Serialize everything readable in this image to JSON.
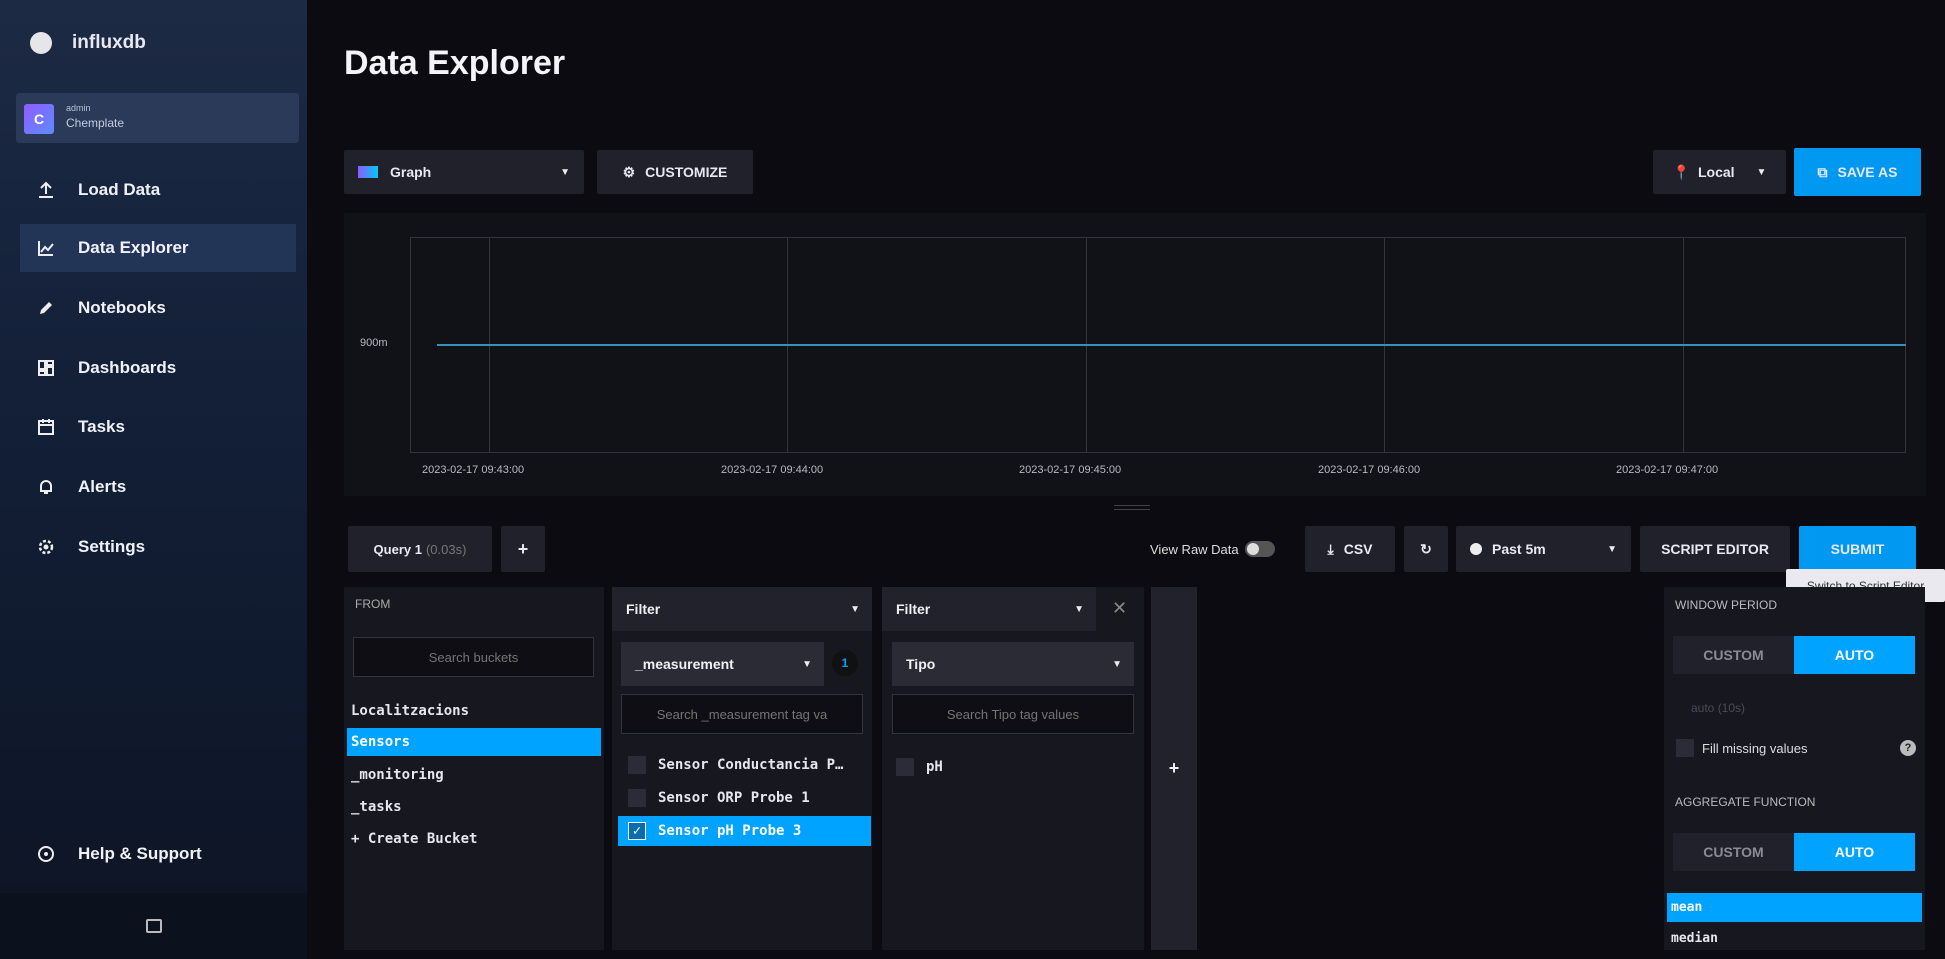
{
  "sidebar": {
    "brand": "influxdb",
    "user": {
      "initial": "C",
      "role": "admin",
      "org": "Chemplate"
    },
    "items": [
      {
        "label": "Load Data",
        "icon": "upload-icon"
      },
      {
        "label": "Data Explorer",
        "icon": "graph-icon"
      },
      {
        "label": "Notebooks",
        "icon": "pencil-icon"
      },
      {
        "label": "Dashboards",
        "icon": "dashboard-grid-icon"
      },
      {
        "label": "Tasks",
        "icon": "calendar-icon"
      },
      {
        "label": "Alerts",
        "icon": "bell-icon"
      },
      {
        "label": "Settings",
        "icon": "gear-icon"
      }
    ],
    "help": "Help & Support"
  },
  "page": {
    "title": "Data Explorer"
  },
  "toolbar": {
    "vis_type": "Graph",
    "customize": "CUSTOMIZE",
    "timezone": "Local",
    "save_as": "SAVE AS"
  },
  "chart_data": {
    "type": "line",
    "y_tick": "900m",
    "x_ticks": [
      "2023-02-17 09:43:00",
      "2023-02-17 09:44:00",
      "2023-02-17 09:45:00",
      "2023-02-17 09:46:00",
      "2023-02-17 09:47:00"
    ],
    "series": [
      {
        "values": [
          0.9,
          0.9
        ]
      }
    ]
  },
  "query_bar": {
    "tab": "Query 1",
    "tab_time": "(0.03s)",
    "add": "+",
    "view_raw": "View Raw Data",
    "csv": "CSV",
    "range": "Past 5m",
    "script_editor": "SCRIPT EDITOR",
    "submit": "SUBMIT",
    "tooltip": "Switch to Script Editor"
  },
  "from": {
    "head": "FROM",
    "placeholder": "Search buckets",
    "buckets": [
      "Localitzacions",
      "Sensors",
      "_monitoring",
      "_tasks",
      "+ Create Bucket"
    ],
    "selected": "Sensors"
  },
  "filter1": {
    "head": "Filter",
    "key": "_measurement",
    "count": "1",
    "placeholder": "Search _measurement tag va",
    "values": [
      "Sensor Conductancia P…",
      "Sensor ORP Probe 1",
      "Sensor pH Probe 3"
    ]
  },
  "filter2": {
    "head": "Filter",
    "key": "Tipo",
    "placeholder": "Search Tipo tag values",
    "values": [
      "pH"
    ]
  },
  "add_filter": "+",
  "window": {
    "head": "WINDOW PERIOD",
    "custom": "CUSTOM",
    "auto": "AUTO",
    "auto_value": "auto (10s)",
    "fill": "Fill missing values",
    "agg_head": "AGGREGATE FUNCTION",
    "functions": [
      "mean",
      "median"
    ]
  }
}
